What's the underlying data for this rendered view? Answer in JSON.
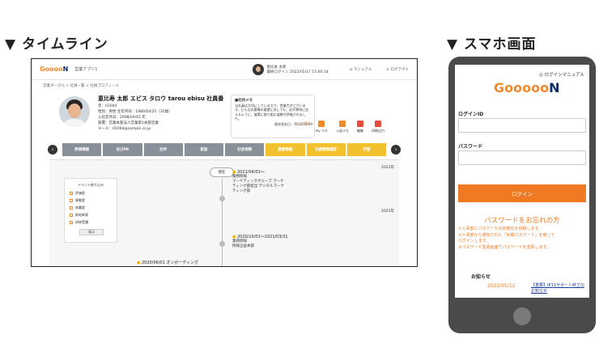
{
  "sections": {
    "timeline_heading": "▼ タイムライン",
    "mobile_heading": "▼ スマホ画面"
  },
  "desktop": {
    "logo_main": "Goooo",
    "logo_n": "N",
    "site_label": "営業アプリ1",
    "user_name": "恵比寿 太郎",
    "user_meta": "最終ログイン 2022/05/17 15:00:18",
    "manual_label": "◎ マニュアル",
    "logout_label": "⊳ ログアウト",
    "breadcrumb": "営業ポータル > 社員一覧 > 社員プロフィール",
    "profile": {
      "name": "恵比寿 太郎 エビス タロウ tarou ebisu 社員番",
      "line1": "年：01004",
      "line2": "性別：男性 生年月日：1980/04/25（35歳）",
      "line3": "入社年月日：2008/04/01 年",
      "line4": "部署：営業本部法人営業第1本部営業",
      "line5": "メール：01004@sample.co.jp"
    },
    "note": {
      "title": "■社内メモ",
      "body": "当社員は大切にしている方で、営業力がございます。どんなお客様の要望に対しても、必ず期待に応えるように、誠実に取り組む姿勢が評価されました。",
      "more": "もっと見る"
    },
    "icons": [
      {
        "label": "my メモ",
        "color": "#f08a2e"
      },
      {
        "label": "入退メモ",
        "color": "#f08a2e"
      },
      {
        "label": "編集",
        "color": "#e84c3d"
      },
      {
        "label": "印刷出力",
        "color": "#e84c3d"
      }
    ],
    "updated": "最終更新日：2022/05/09",
    "tabs": [
      {
        "label": "評価情報",
        "color": "#8a9099"
      },
      {
        "label": "自己PR",
        "color": "#8a9099"
      },
      {
        "label": "住所",
        "color": "#8a9099"
      },
      {
        "label": "家族",
        "color": "#8a9099"
      },
      {
        "label": "社会保険",
        "color": "#8a9099"
      },
      {
        "label": "健康情報",
        "color": "#f2c12e"
      },
      {
        "label": "社員情報補足",
        "color": "#f2c12e"
      },
      {
        "label": "学歴",
        "color": "#f2c12e"
      }
    ],
    "filter": {
      "title": "イベント絞り込み",
      "items": [
        "評価歴",
        "異動歴",
        "休職歴",
        "昇給昇格",
        "研修受講"
      ],
      "button": "表示"
    },
    "now_label": "現在",
    "events": [
      {
        "date": "2021/04/01〜",
        "l1": "業務情報",
        "l2": "マーケティンググループ マーケ",
        "l3": "ティング部担当 デジタルマーケ",
        "l4": "ティング部"
      },
      {
        "date": "2020/10/01〜2021/03/31",
        "l1": "業務情報",
        "l2": "情報企画本部",
        "l3": "",
        "l4": ""
      },
      {
        "date": "2020/06/01 オンボーディング",
        "l1": "",
        "l2": "",
        "l3": "",
        "l4": ""
      }
    ],
    "years": [
      "2022年",
      "2021年"
    ]
  },
  "mobile": {
    "manual": "◎ ログインマニュアル",
    "logo_main": "Gooooo",
    "logo_n": "N",
    "login_id_label": "ログインID",
    "password_label": "パスワード",
    "login_button": "ログイン",
    "forgot_title": "パスワードをお忘れの方",
    "steps": [
      "①人事部にパスワードの初期化を依頼します。",
      "②人事部から通知された「初期パスワード」を使って",
      "ログインします。",
      "③パスワード変更画面でパスワードを変更します。"
    ],
    "news_title": "お知らせ",
    "news_date": "2022/05/12",
    "news_text": "【重要】IE11サポート終了のお知らせ"
  }
}
